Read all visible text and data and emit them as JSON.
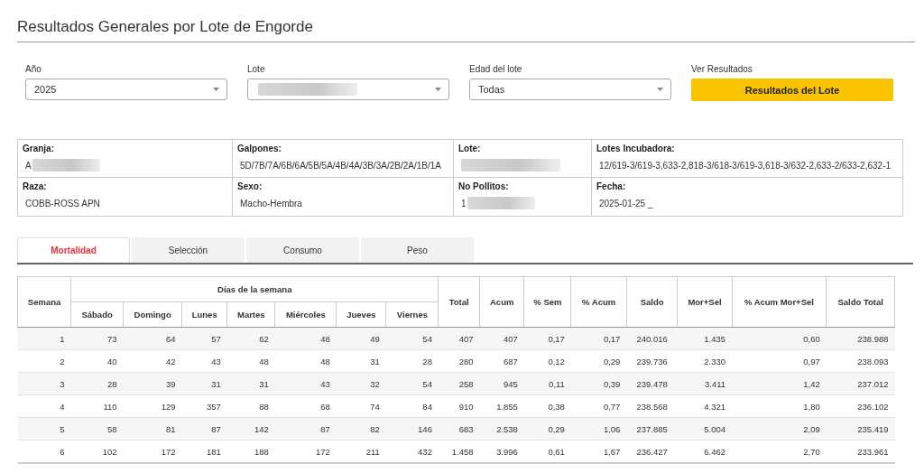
{
  "page_title": "Resultados Generales por Lote de Engorde",
  "filters": [
    {
      "kind": "select",
      "label": "Año",
      "value": "2025",
      "redacted": false
    },
    {
      "kind": "select",
      "label": "Lote",
      "redacted": true
    },
    {
      "kind": "select",
      "label": "Edad del lote",
      "value": "Todas",
      "redacted": false
    },
    {
      "kind": "button",
      "label": "Ver Resultados",
      "value": "Resultados del Lote"
    }
  ],
  "info": [
    [
      {
        "label": "Granja:",
        "value": "A",
        "redacted": true
      },
      {
        "label": "Galpones:",
        "value": "5D/7B/7A/6B/6A/5B/5A/4B/4A/3B/3A/2B/2A/1B/1A",
        "redacted": false
      },
      {
        "label": "Lote:",
        "redacted": true
      },
      {
        "label": "Lotes Incubadora:",
        "value": "12/619-3/619-3,633-2,818-3/618-3/619-3,618-3/632-2,633-2/633-2,632-1",
        "redacted": false
      }
    ],
    [
      {
        "label": "Raza:",
        "value": "COBB-ROSS APN",
        "redacted": false
      },
      {
        "label": "Sexo:",
        "value": "Macho-Hembra",
        "redacted": false
      },
      {
        "label": "No Pollitos:",
        "value": "1",
        "redacted": true
      },
      {
        "label": "Fecha:",
        "value": "2025-01-25 _",
        "redacted": false
      }
    ]
  ],
  "tabs": [
    {
      "label": "Mortalidad",
      "selected": true
    },
    {
      "label": "Selección",
      "selected": false
    },
    {
      "label": "Consumo",
      "selected": false
    },
    {
      "label": "Peso",
      "selected": false
    }
  ],
  "table": {
    "group_header": "Días de la semana",
    "columns": [
      "Semana",
      "Sábado",
      "Domingo",
      "Lunes",
      "Martes",
      "Miércoles",
      "Jueves",
      "Viernes",
      "Total",
      "Acum",
      "% Sem",
      "% Acum",
      "Saldo",
      "Mor+Sel",
      "% Acum Mor+Sel",
      "Saldo Total"
    ],
    "rows": [
      [
        "1",
        "73",
        "64",
        "57",
        "62",
        "48",
        "49",
        "54",
        "407",
        "407",
        "0,17",
        "0,17",
        "240.016",
        "1.435",
        "0,60",
        "238.988"
      ],
      [
        "2",
        "40",
        "42",
        "43",
        "48",
        "48",
        "31",
        "28",
        "280",
        "687",
        "0,12",
        "0,29",
        "239.736",
        "2.330",
        "0,97",
        "238.093"
      ],
      [
        "3",
        "28",
        "39",
        "31",
        "31",
        "43",
        "32",
        "54",
        "258",
        "945",
        "0,11",
        "0,39",
        "239.478",
        "3.411",
        "1,42",
        "237.012"
      ],
      [
        "4",
        "110",
        "129",
        "357",
        "88",
        "68",
        "74",
        "84",
        "910",
        "1.855",
        "0,38",
        "0,77",
        "238.568",
        "4.321",
        "1,80",
        "236.102"
      ],
      [
        "5",
        "58",
        "81",
        "87",
        "142",
        "87",
        "82",
        "146",
        "683",
        "2.538",
        "0,29",
        "1,06",
        "237.885",
        "5.004",
        "2,09",
        "235.419"
      ],
      [
        "6",
        "102",
        "172",
        "181",
        "188",
        "172",
        "211",
        "432",
        "1.458",
        "3.996",
        "0,61",
        "1,67",
        "236.427",
        "6.462",
        "2,70",
        "233.961"
      ]
    ]
  }
}
